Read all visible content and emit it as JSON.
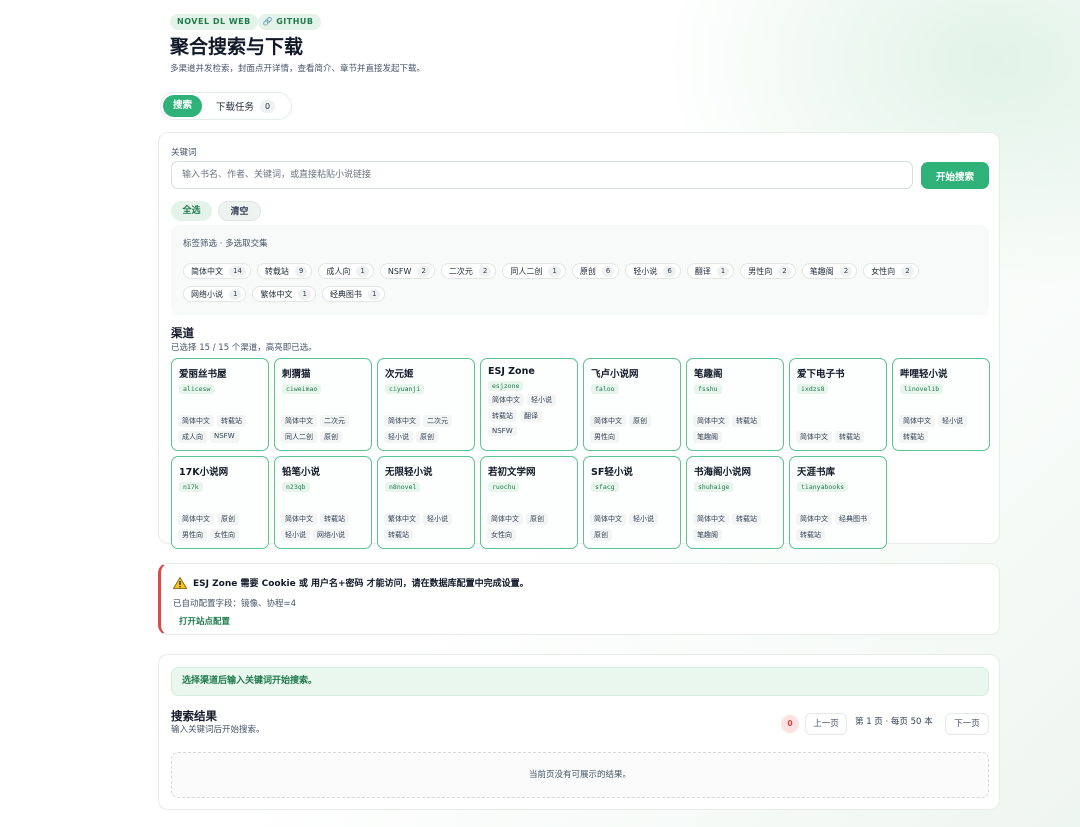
{
  "header": {
    "badge": "NOVEL DL WEB",
    "github": "GITHUB",
    "title": "聚合搜索与下载",
    "subtitle": "多渠道并发检索，封面点开详情，查看简介、章节并直接发起下载。"
  },
  "tabs": {
    "search": "搜索",
    "downloads": "下载任务",
    "downloads_count": "0"
  },
  "search": {
    "label": "关键词",
    "placeholder": "输入书名、作者、关键词，或直接粘贴小说链接",
    "value": "",
    "submit": "开始搜索",
    "select_all": "全选",
    "clear": "清空"
  },
  "tag_filter": {
    "title": "标签筛选 · 多选取交集",
    "tags": [
      {
        "label": "简体中文",
        "count": "14"
      },
      {
        "label": "转载站",
        "count": "9"
      },
      {
        "label": "成人向",
        "count": "1"
      },
      {
        "label": "NSFW",
        "count": "2"
      },
      {
        "label": "二次元",
        "count": "2"
      },
      {
        "label": "同人二创",
        "count": "1"
      },
      {
        "label": "原创",
        "count": "6"
      },
      {
        "label": "轻小说",
        "count": "6"
      },
      {
        "label": "翻译",
        "count": "1"
      },
      {
        "label": "男性向",
        "count": "2"
      },
      {
        "label": "笔趣阁",
        "count": "2"
      },
      {
        "label": "女性向",
        "count": "2"
      },
      {
        "label": "网络小说",
        "count": "1"
      },
      {
        "label": "繁体中文",
        "count": "1"
      },
      {
        "label": "经典图书",
        "count": "1"
      }
    ]
  },
  "channels": {
    "title": "渠道",
    "subtitle": "已选择 15 / 15 个渠道，高亮即已选。",
    "items": [
      {
        "name": "爱丽丝书屋",
        "id": "alicesw",
        "tags": [
          "简体中文",
          "转载站",
          "成人向",
          "NSFW"
        ]
      },
      {
        "name": "刺猬猫",
        "id": "ciweimao",
        "tags": [
          "简体中文",
          "二次元",
          "同人二创",
          "原创"
        ]
      },
      {
        "name": "次元姬",
        "id": "ciyuanji",
        "tags": [
          "简体中文",
          "二次元",
          "轻小说",
          "原创"
        ]
      },
      {
        "name": "ESJ Zone",
        "id": "esjzone",
        "tags": [
          "简体中文",
          "轻小说",
          "转载站",
          "翻译",
          "NSFW"
        ],
        "top": true
      },
      {
        "name": "飞卢小说网",
        "id": "faloo",
        "tags": [
          "简体中文",
          "原创",
          "男性向"
        ]
      },
      {
        "name": "笔趣阁",
        "id": "fsshu",
        "tags": [
          "简体中文",
          "转载站",
          "笔趣阁"
        ]
      },
      {
        "name": "爱下电子书",
        "id": "ixdzs8",
        "tags": [
          "简体中文",
          "转载站"
        ]
      },
      {
        "name": "哔哩轻小说",
        "id": "linovelib",
        "tags": [
          "简体中文",
          "轻小说",
          "转载站"
        ]
      },
      {
        "name": "17K小说网",
        "id": "n17k",
        "tags": [
          "简体中文",
          "原创",
          "男性向",
          "女性向"
        ]
      },
      {
        "name": "铅笔小说",
        "id": "n23qb",
        "tags": [
          "简体中文",
          "转载站",
          "轻小说",
          "网络小说"
        ]
      },
      {
        "name": "无限轻小说",
        "id": "n8novel",
        "tags": [
          "繁体中文",
          "轻小说",
          "转载站"
        ]
      },
      {
        "name": "若初文学网",
        "id": "ruochu",
        "tags": [
          "简体中文",
          "原创",
          "女性向"
        ]
      },
      {
        "name": "SF轻小说",
        "id": "sfacg",
        "tags": [
          "简体中文",
          "轻小说",
          "原创"
        ]
      },
      {
        "name": "书海阁小说网",
        "id": "shuhaige",
        "tags": [
          "简体中文",
          "转载站",
          "笔趣阁"
        ]
      },
      {
        "name": "天涯书库",
        "id": "tianyabooks",
        "tags": [
          "简体中文",
          "经典图书",
          "转载站"
        ]
      }
    ]
  },
  "warning": {
    "title": "ESJ Zone 需要 Cookie 或 用户名+密码 才能访问，请在数据库配置中完成设置。",
    "detail": "已自动配置字段：镜像、协程=4",
    "link": "打开站点配置",
    "accent": "#e04848"
  },
  "results": {
    "hint": "选择渠道后输入关键词开始搜索。",
    "title": "搜索结果",
    "subtitle": "输入关键词后开始搜索。",
    "count": "0",
    "prev": "上一页",
    "page_info": "第 1 页 · 每页 50 本",
    "next": "下一页",
    "empty": "当前页没有可展示的结果。"
  },
  "colors": {
    "accent": "#2fb27a",
    "accent_dark": "#1f7a4c",
    "danger": "#e04848"
  }
}
